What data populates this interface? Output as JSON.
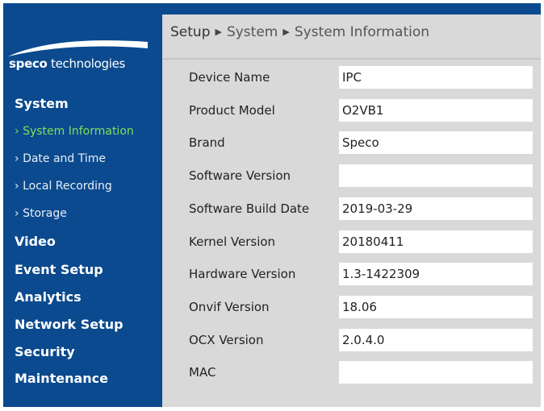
{
  "logo": {
    "brand_bold": "speco",
    "brand_rest": " technologies"
  },
  "breadcrumb": [
    "Setup",
    "System",
    "System Information"
  ],
  "sidebar": {
    "system": "System",
    "sub": [
      {
        "label": "System Information",
        "active": true
      },
      {
        "label": "Date and Time"
      },
      {
        "label": "Local Recording"
      },
      {
        "label": "Storage"
      }
    ],
    "sections": [
      "Video",
      "Event Setup",
      "Analytics",
      "Network Setup",
      "Security",
      "Maintenance"
    ]
  },
  "fields": [
    {
      "label": "Device Name",
      "value": "IPC"
    },
    {
      "label": "Product Model",
      "value": "O2VB1"
    },
    {
      "label": "Brand",
      "value": "Speco"
    },
    {
      "label": "Software Version",
      "value": ""
    },
    {
      "label": "Software Build Date",
      "value": "2019-03-29"
    },
    {
      "label": "Kernel Version",
      "value": "20180411"
    },
    {
      "label": "Hardware Version",
      "value": "1.3-1422309"
    },
    {
      "label": "Onvif Version",
      "value": "18.06"
    },
    {
      "label": "OCX Version",
      "value": "2.0.4.0"
    },
    {
      "label": "MAC",
      "value": ""
    }
  ],
  "colors": {
    "sidebar": "#0b4a8e",
    "active": "#7fe05a",
    "content": "#d9d9d9"
  }
}
